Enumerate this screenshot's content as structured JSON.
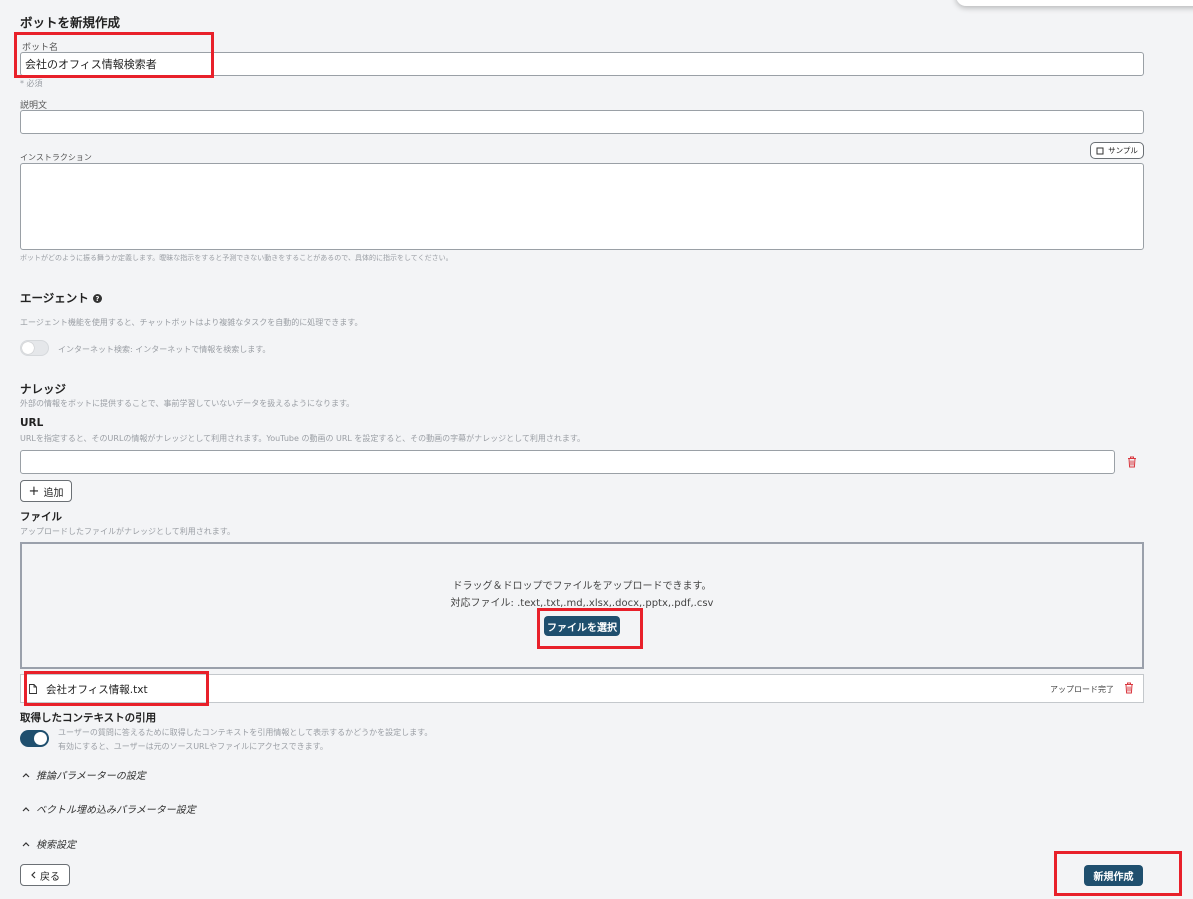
{
  "page": {
    "title": "ボットを新規作成"
  },
  "bot_name": {
    "label": "ボット名",
    "value": "会社のオフィス情報検索者",
    "required_note": "* 必須"
  },
  "description": {
    "label": "説明文",
    "value": ""
  },
  "instruction": {
    "label": "インストラクション",
    "sample_button": "サンプル",
    "value": "",
    "hint": "ボットがどのように振る舞うか定義します。曖昧な指示をすると予測できない動きをすることがあるので、具体的に指示をしてください。"
  },
  "agent": {
    "title": "エージェント",
    "description": "エージェント機能を使用すると、チャットボットはより複雑なタスクを自動的に処理できます。",
    "internet_search_label": "インターネット検索: インターネットで情報を検索します。",
    "internet_search_enabled": false
  },
  "knowledge": {
    "title": "ナレッジ",
    "description": "外部の情報をボットに提供することで、事前学習していないデータを扱えるようになります。",
    "url": {
      "title": "URL",
      "description": "URLを指定すると、そのURLの情報がナレッジとして利用されます。YouTube の動画の URL を設定すると、その動画の字幕がナレッジとして利用されます。",
      "value": "",
      "add_button": "追加"
    },
    "file": {
      "title": "ファイル",
      "description": "アップロードしたファイルがナレッジとして利用されます。",
      "drop_text": "ドラッグ＆ドロップでファイルをアップロードできます。",
      "supported_text": "対応ファイル: .text,.txt,.md,.xlsx,.docx,.pptx,.pdf,.csv",
      "select_button": "ファイルを選択",
      "uploaded": [
        {
          "name": "会社オフィス情報.txt",
          "status": "アップロード完了"
        }
      ]
    }
  },
  "citation": {
    "title": "取得したコンテキストの引用",
    "line1": "ユーザーの質問に答えるために取得したコンテキストを引用情報として表示するかどうかを設定します。",
    "line2": "有効にすると、ユーザーは元のソースURLやファイルにアクセスできます。",
    "enabled": true
  },
  "collapsibles": {
    "inference": "推論パラメーターの設定",
    "embedding": "ベクトル埋め込みパラメーター設定",
    "search": "検索設定"
  },
  "footer": {
    "back_button": "戻る",
    "create_button": "新規作成"
  },
  "colors": {
    "primary": "#1f4f6e",
    "highlight": "#e8202a",
    "danger": "#d9363e"
  }
}
